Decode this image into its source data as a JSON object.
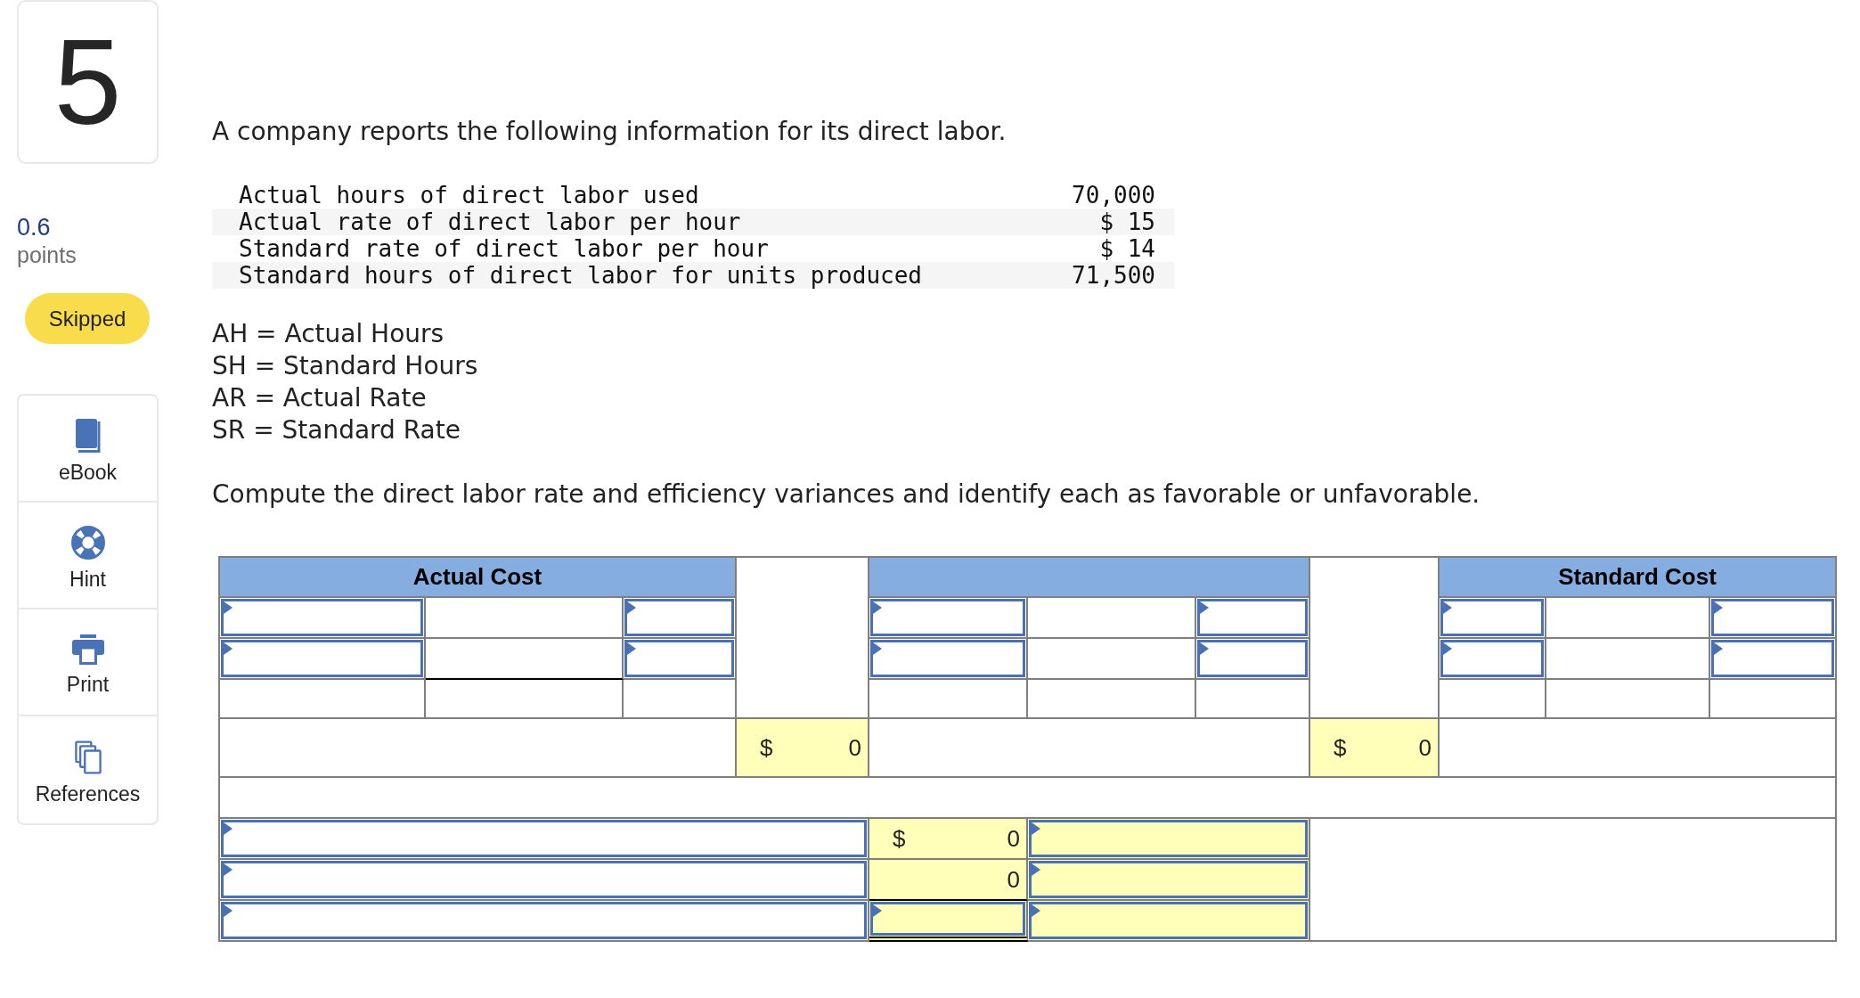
{
  "question": {
    "number": "5",
    "points": "0.6",
    "points_label": "points",
    "status": "Skipped"
  },
  "tools": [
    {
      "label": "eBook"
    },
    {
      "label": "Hint"
    },
    {
      "label": "Print"
    },
    {
      "label": "References"
    }
  ],
  "prompt": "A company reports the following information for its direct labor.",
  "given_data": [
    {
      "label": "Actual hours of direct labor used",
      "value": "70,000"
    },
    {
      "label": "Actual rate of direct labor per hour",
      "value": "$ 15"
    },
    {
      "label": "Standard rate of direct labor per hour",
      "value": "$ 14"
    },
    {
      "label": "Standard hours of direct labor for units produced",
      "value": "71,500"
    }
  ],
  "definitions": [
    "AH = Actual Hours",
    "SH = Standard Hours",
    "AR = Actual Rate",
    "SR = Standard Rate"
  ],
  "instruction": "Compute the direct labor rate and efficiency variances and identify each as favorable or unfavorable.",
  "worksheet": {
    "sections": [
      {
        "heading": "Actual Cost",
        "rows": [
          [
            {
              "kind": "dropdown"
            },
            {
              "kind": "blank"
            },
            {
              "kind": "dropdown"
            }
          ],
          [
            {
              "kind": "dropdown"
            },
            {
              "kind": "blank",
              "underline": true
            },
            {
              "kind": "dropdown"
            }
          ],
          [
            {
              "kind": "blank"
            },
            {
              "kind": "blank"
            },
            {
              "kind": "blank"
            }
          ]
        ]
      },
      {
        "rows": [
          [
            {
              "kind": "dropdown"
            },
            {
              "kind": "blank"
            },
            {
              "kind": "dropdown"
            }
          ],
          [
            {
              "kind": "dropdown"
            },
            {
              "kind": "blank"
            },
            {
              "kind": "dropdown"
            }
          ],
          [
            {
              "kind": "blank"
            },
            {
              "kind": "blank"
            },
            {
              "kind": "blank"
            }
          ]
        ]
      },
      {
        "heading": "Standard Cost",
        "rows": [
          [
            {
              "kind": "dropdown"
            },
            {
              "kind": "blank"
            },
            {
              "kind": "dropdown"
            }
          ],
          [
            {
              "kind": "dropdown"
            },
            {
              "kind": "blank"
            },
            {
              "kind": "dropdown"
            }
          ],
          [
            {
              "kind": "blank"
            },
            {
              "kind": "blank"
            },
            {
              "kind": "blank"
            }
          ]
        ]
      }
    ],
    "totals": [
      {
        "kind": "value",
        "currency": "$",
        "value": "0",
        "highlighted": true
      },
      {
        "kind": "value",
        "currency": "$",
        "value": "0",
        "highlighted": true
      }
    ],
    "variances": [
      {
        "label": {
          "kind": "dropdown",
          "highlighted": false
        },
        "amount": {
          "kind": "value",
          "currency": "$",
          "value": "0",
          "highlighted": true
        },
        "result": {
          "kind": "dropdown",
          "highlighted": true
        }
      },
      {
        "label": {
          "kind": "dropdown",
          "highlighted": false
        },
        "amount": {
          "kind": "value",
          "value": "0",
          "highlighted": true,
          "underline": true
        },
        "result": {
          "kind": "dropdown",
          "highlighted": true
        }
      },
      {
        "label": {
          "kind": "dropdown",
          "highlighted": false
        },
        "amount": {
          "kind": "dropdown",
          "highlighted": true,
          "double_underline": true
        },
        "result": {
          "kind": "dropdown",
          "highlighted": true
        }
      }
    ]
  }
}
